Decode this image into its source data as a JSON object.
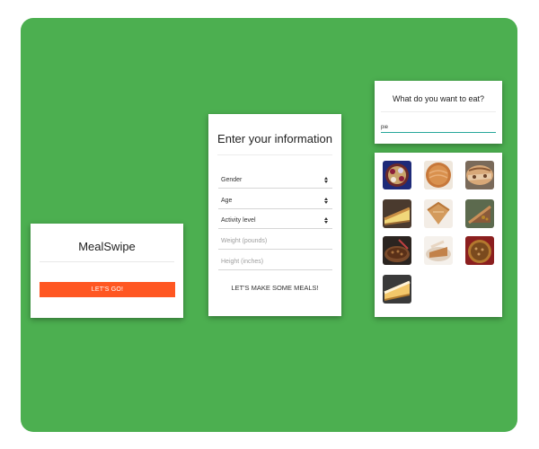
{
  "welcome_card": {
    "title": "MealSwipe",
    "cta_label": "LET'S GO!"
  },
  "info_card": {
    "title": "Enter your information",
    "gender_label": "Gender",
    "age_label": "Age",
    "activity_label": "Activity level",
    "weight_placeholder": "Weight (pounds)",
    "height_placeholder": "Height (inches)",
    "submit_label": "LET'S MAKE SOME MEALS!"
  },
  "search_card": {
    "title": "What do you want to eat?",
    "query": "pie"
  },
  "results": {
    "items": [
      {
        "name": "pie-image-1"
      },
      {
        "name": "pie-image-2"
      },
      {
        "name": "pie-image-3"
      },
      {
        "name": "pie-image-4"
      },
      {
        "name": "pie-image-5"
      },
      {
        "name": "pie-image-6"
      },
      {
        "name": "pie-image-7"
      },
      {
        "name": "pie-image-8"
      },
      {
        "name": "pie-image-9"
      },
      {
        "name": "pie-image-10"
      }
    ]
  },
  "colors": {
    "background": "#4caf50",
    "accent": "#ff5722",
    "input_underline": "#26a69a"
  }
}
